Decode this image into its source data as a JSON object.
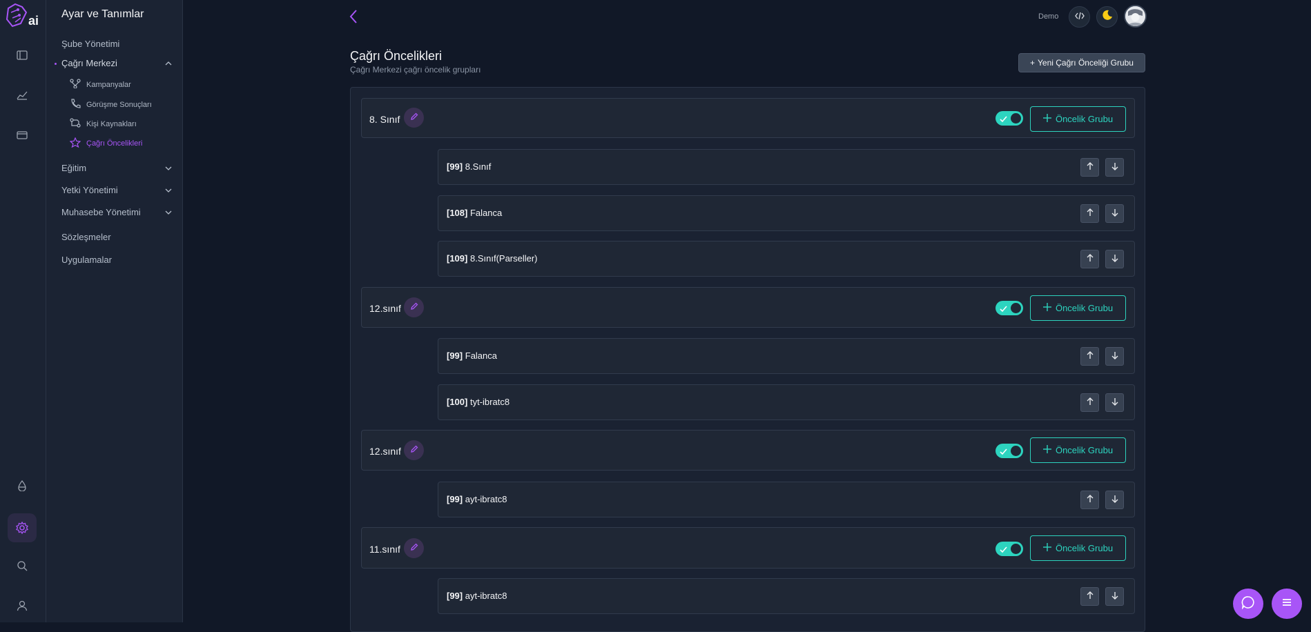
{
  "app": {
    "logo_text": "ai"
  },
  "rail": {
    "icons": [
      "sidebar-toggle-icon",
      "chart-icon",
      "card-icon",
      "drop-icon",
      "settings-icon",
      "search-icon",
      "user-icon"
    ]
  },
  "sidebar": {
    "title": "Ayar ve Tanımlar",
    "items": [
      {
        "label": "Şube Yönetimi"
      },
      {
        "label": "Çağrı Merkezi"
      },
      {
        "label": "Eğitim"
      },
      {
        "label": "Yetki Yönetimi"
      },
      {
        "label": "Muhasebe Yönetimi"
      },
      {
        "label": "Sözleşmeler"
      },
      {
        "label": "Uygulamalar"
      }
    ],
    "subitems": [
      {
        "label": "Kampanyalar",
        "icon": "branch-icon"
      },
      {
        "label": "Görüşme Sonuçları",
        "icon": "phone-icon"
      },
      {
        "label": "Kişi Kaynakları",
        "icon": "flow-icon"
      },
      {
        "label": "Çağrı Öncelikleri",
        "icon": "star-icon"
      }
    ]
  },
  "header": {
    "demo_label": "Demo"
  },
  "page": {
    "title": "Çağrı Öncelikleri",
    "subtitle": "Çağrı Merkezi çağrı öncelik grupları",
    "new_button": "Yeni Çağrı Önceliği Grubu",
    "group_button": "Öncelik Grubu"
  },
  "groups": [
    {
      "name": "8. Sınıf",
      "enabled": true,
      "rows": [
        {
          "id": "[99]",
          "name": "8.Sınıf"
        },
        {
          "id": "[108]",
          "name": "Falanca"
        },
        {
          "id": "[109]",
          "name": "8.Sınıf(Parseller)"
        }
      ]
    },
    {
      "name": "12.sınıf",
      "enabled": true,
      "rows": [
        {
          "id": "[99]",
          "name": "Falanca"
        },
        {
          "id": "[100]",
          "name": "tyt-ibratc8"
        }
      ]
    },
    {
      "name": "12.sınıf",
      "enabled": true,
      "rows": [
        {
          "id": "[99]",
          "name": "ayt-ibratc8"
        }
      ]
    },
    {
      "name": "11.sınıf",
      "enabled": true,
      "rows": [
        {
          "id": "[99]",
          "name": "ayt-ibratc8"
        }
      ]
    }
  ],
  "colors": {
    "accent": "#a855f7",
    "teal": "#2dd4bf",
    "bg": "#111827",
    "panel": "#1f2735"
  }
}
